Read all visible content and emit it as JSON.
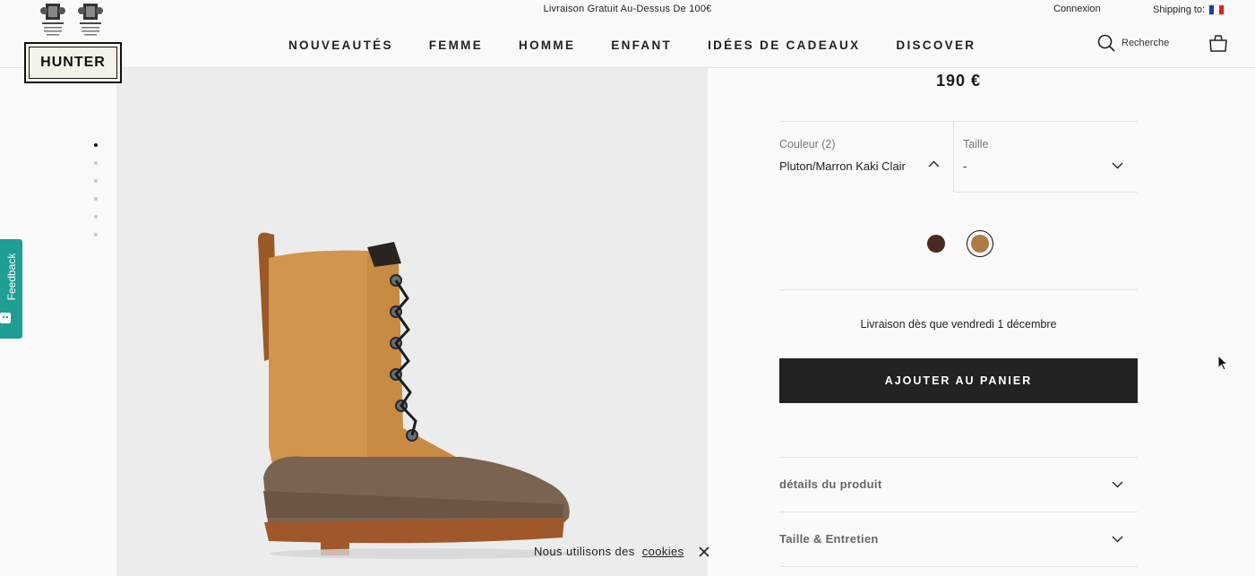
{
  "header": {
    "promo": "Livraison Gratuit Au-Dessus De 100€",
    "login": "Connexion",
    "shipping_label": "Shipping to:",
    "logo_text": "HUNTER",
    "nav": [
      "NOUVEAUTÉS",
      "FEMME",
      "HOMME",
      "ENFANT",
      "IDÉES DE CADEAUX",
      "DISCOVER"
    ],
    "search_label": "Recherche"
  },
  "feedback": {
    "label": "Feedback"
  },
  "gallery": {
    "image_count": 6,
    "active_index": 0
  },
  "product": {
    "price": "190 €",
    "color_label": "Couleur (2)",
    "color_value": "Pluton/Marron Kaki Clair",
    "size_label": "Taille",
    "size_value": "-",
    "swatches": [
      {
        "color": "#4a2a22",
        "selected": false
      },
      {
        "color": "#b07a45",
        "selected": true
      }
    ],
    "delivery": "Livraison dès que vendredi 1 décembre",
    "add_to_cart": "AJOUTER AU PANIER",
    "accordions": [
      "détails du produit",
      "Taille & Entretien"
    ]
  },
  "cookie": {
    "text": "Nous utilisons des",
    "link": "cookies"
  },
  "colors": {
    "feedback": "#1f9e94",
    "button": "#222222",
    "image_bg": "#ececec"
  }
}
